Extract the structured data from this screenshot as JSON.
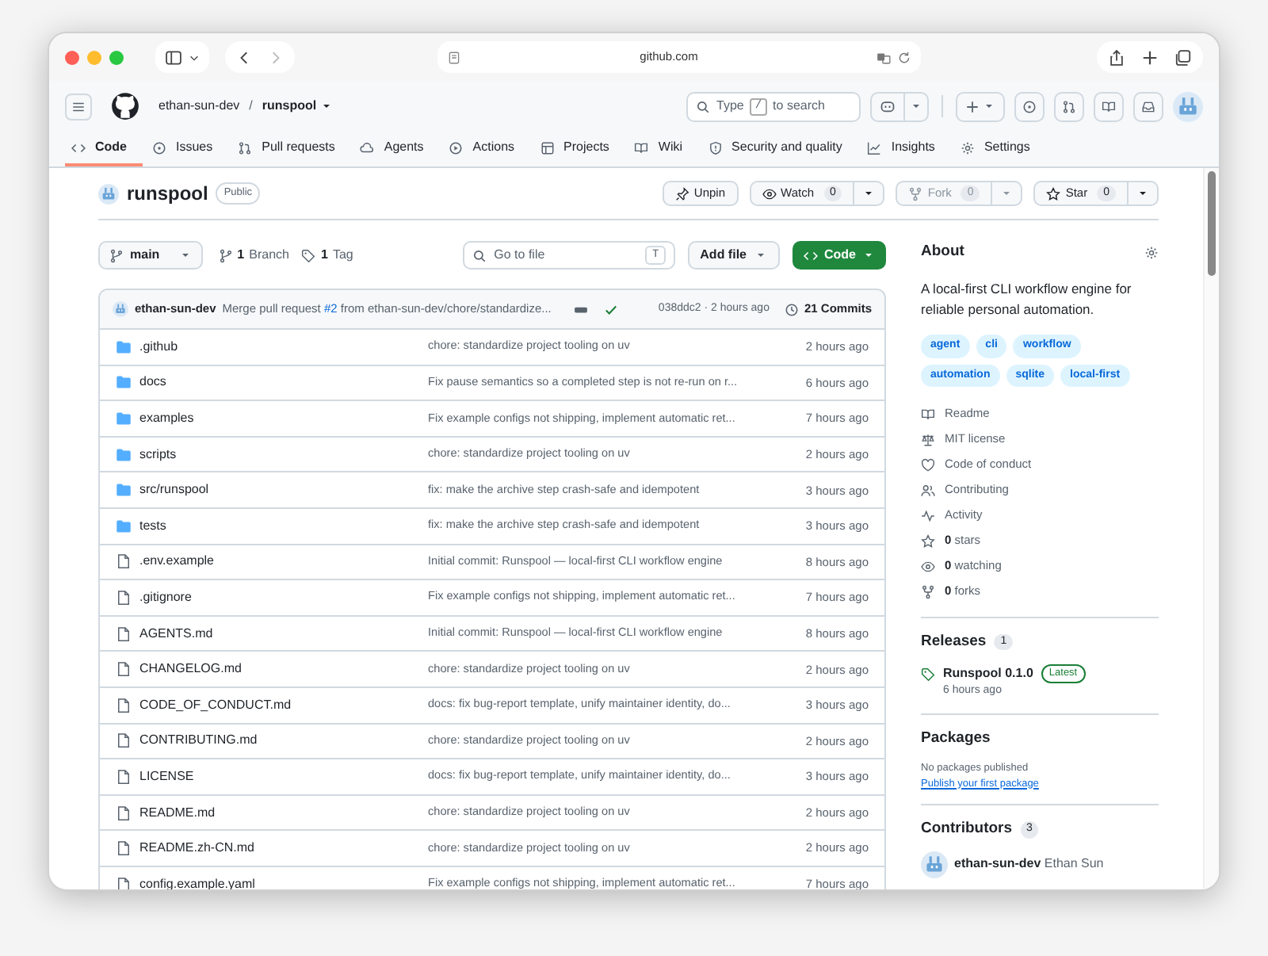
{
  "browser": {
    "address": "github.com"
  },
  "header": {
    "owner": "ethan-sun-dev",
    "separator": "/",
    "repo": "runspool",
    "search": {
      "prefix": "Type",
      "key": "/",
      "suffix": "to search"
    }
  },
  "tabs": [
    {
      "label": "Code",
      "selected": true
    },
    {
      "label": "Issues",
      "selected": false
    },
    {
      "label": "Pull requests",
      "selected": false
    },
    {
      "label": "Agents",
      "selected": false
    },
    {
      "label": "Actions",
      "selected": false
    },
    {
      "label": "Projects",
      "selected": false
    },
    {
      "label": "Wiki",
      "selected": false
    },
    {
      "label": "Security and quality",
      "selected": false
    },
    {
      "label": "Insights",
      "selected": false
    },
    {
      "label": "Settings",
      "selected": false
    }
  ],
  "repo": {
    "name": "runspool",
    "visibility": "Public"
  },
  "repo_actions": [
    {
      "kind": "pin",
      "label": "Unpin",
      "disabled": false
    },
    {
      "kind": "watch",
      "label": "Watch",
      "count": "0",
      "disabled": false
    },
    {
      "kind": "fork",
      "label": "Fork",
      "count": "0",
      "disabled": true
    },
    {
      "kind": "star",
      "label": "Star",
      "count": "0",
      "disabled": false
    }
  ],
  "toolbar": {
    "branch": "main",
    "branch_count": "1",
    "branch_label": "Branch",
    "tag_count": "1",
    "tag_label": "Tag",
    "goto_placeholder": "Go to file",
    "goto_key": "T",
    "add_file": "Add file",
    "code": "Code"
  },
  "latest_commit": {
    "author": "ethan-sun-dev",
    "message_before": "Merge pull request ",
    "link": "#2",
    "message_after": " from ethan-sun-dev/chore/standardize...",
    "checks_passed": true,
    "hash_time": "038ddc2 · 2 hours ago",
    "commits": "21 Commits"
  },
  "files": [
    {
      "kind": "folder",
      "name": ".github",
      "message": "chore: standardize project tooling on uv",
      "time": "2 hours ago"
    },
    {
      "kind": "folder",
      "name": "docs",
      "message": "Fix pause semantics so a completed step is not re-run on r...",
      "time": "6 hours ago"
    },
    {
      "kind": "folder",
      "name": "examples",
      "message": "Fix example configs not shipping, implement automatic ret...",
      "time": "7 hours ago"
    },
    {
      "kind": "folder",
      "name": "scripts",
      "message": "chore: standardize project tooling on uv",
      "time": "2 hours ago"
    },
    {
      "kind": "folder",
      "name": "src/runspool",
      "message": "fix: make the archive step crash-safe and idempotent",
      "time": "3 hours ago"
    },
    {
      "kind": "folder",
      "name": "tests",
      "message": "fix: make the archive step crash-safe and idempotent",
      "time": "3 hours ago"
    },
    {
      "kind": "file",
      "name": ".env.example",
      "message": "Initial commit: Runspool — local-first CLI workflow engine",
      "time": "8 hours ago"
    },
    {
      "kind": "file",
      "name": ".gitignore",
      "message": "Fix example configs not shipping, implement automatic ret...",
      "time": "7 hours ago"
    },
    {
      "kind": "file",
      "name": "AGENTS.md",
      "message": "Initial commit: Runspool — local-first CLI workflow engine",
      "time": "8 hours ago"
    },
    {
      "kind": "file",
      "name": "CHANGELOG.md",
      "message": "chore: standardize project tooling on uv",
      "time": "2 hours ago"
    },
    {
      "kind": "file",
      "name": "CODE_OF_CONDUCT.md",
      "message": "docs: fix bug-report template, unify maintainer identity, do...",
      "time": "3 hours ago"
    },
    {
      "kind": "file",
      "name": "CONTRIBUTING.md",
      "message": "chore: standardize project tooling on uv",
      "time": "2 hours ago"
    },
    {
      "kind": "file",
      "name": "LICENSE",
      "message": "docs: fix bug-report template, unify maintainer identity, do...",
      "time": "3 hours ago"
    },
    {
      "kind": "file",
      "name": "README.md",
      "message": "chore: standardize project tooling on uv",
      "time": "2 hours ago"
    },
    {
      "kind": "file",
      "name": "README.zh-CN.md",
      "message": "chore: standardize project tooling on uv",
      "time": "2 hours ago"
    },
    {
      "kind": "file",
      "name": "config.example.yaml",
      "message": "Fix example configs not shipping, implement automatic ret...",
      "time": "7 hours ago"
    }
  ],
  "about": {
    "heading": "About",
    "description": "A local-first CLI workflow engine for reliable personal automation.",
    "topics": [
      "agent",
      "cli",
      "workflow",
      "automation",
      "sqlite",
      "local-first"
    ],
    "links": [
      {
        "label": "Readme"
      },
      {
        "label": "MIT license"
      },
      {
        "label": "Code of conduct"
      },
      {
        "label": "Contributing"
      },
      {
        "label": "Activity"
      },
      {
        "count": "0",
        "label": "stars"
      },
      {
        "count": "0",
        "label": "watching"
      },
      {
        "count": "0",
        "label": "forks"
      }
    ]
  },
  "releases": {
    "heading": "Releases",
    "count": "1",
    "items": [
      {
        "name": "Runspool 0.1.0",
        "badge": "Latest",
        "time": "6 hours ago"
      }
    ]
  },
  "packages": {
    "heading": "Packages",
    "note": "No packages published",
    "link": "Publish your first package"
  },
  "contributors": {
    "heading": "Contributors",
    "count": "3",
    "items": [
      {
        "login": "ethan-sun-dev",
        "name": "Ethan Sun"
      }
    ]
  }
}
